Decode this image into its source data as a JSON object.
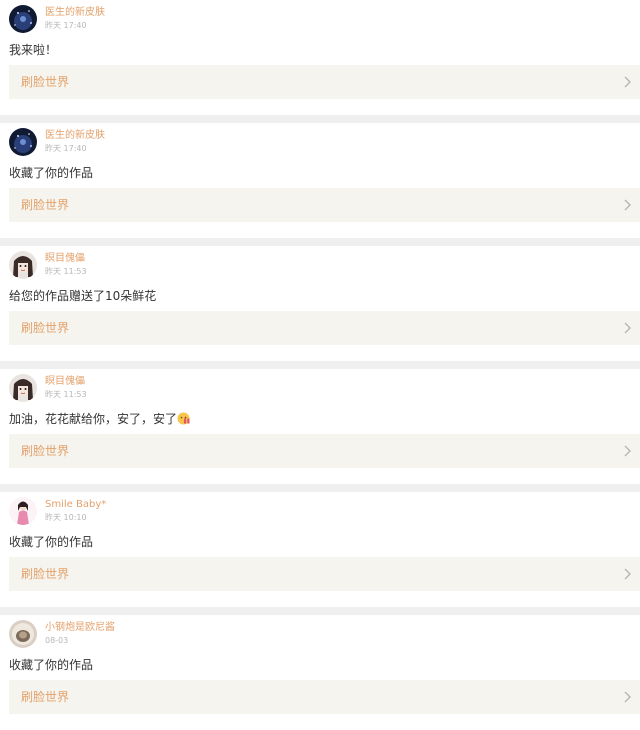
{
  "notifications": [
    {
      "username": "医生的新皮肤",
      "time": "昨天 17:40",
      "message": "我来啦！",
      "work_title": "刷脸世界",
      "avatar": "galaxy"
    },
    {
      "username": "医生的新皮肤",
      "time": "昨天 17:40",
      "message": "收藏了你的作品",
      "work_title": "刷脸世界",
      "avatar": "galaxy"
    },
    {
      "username": "瞑目傀儡",
      "time": "昨天 11:53",
      "message": "给您的作品赠送了10朵鲜花",
      "work_title": "刷脸世界",
      "avatar": "doll"
    },
    {
      "username": "瞑目傀儡",
      "time": "昨天 11:53",
      "message": "加油，花花献给你，安了，安了",
      "work_title": "刷脸世界",
      "avatar": "doll",
      "emoji": "gift-emoji"
    },
    {
      "username": "Smile Baby*",
      "time": "昨天 10:10",
      "message": "收藏了你的作品",
      "work_title": "刷脸世界",
      "avatar": "girl-pink"
    },
    {
      "username": "小钢炮是欧尼酱",
      "time": "08-03",
      "message": "收藏了你的作品",
      "work_title": "刷脸世界",
      "avatar": "photo-brown"
    }
  ],
  "colors": {
    "accent": "#e3a26c",
    "time_gray": "#b7b7b7",
    "link_bg": "#f5f4ee",
    "separator": "#efefef"
  }
}
